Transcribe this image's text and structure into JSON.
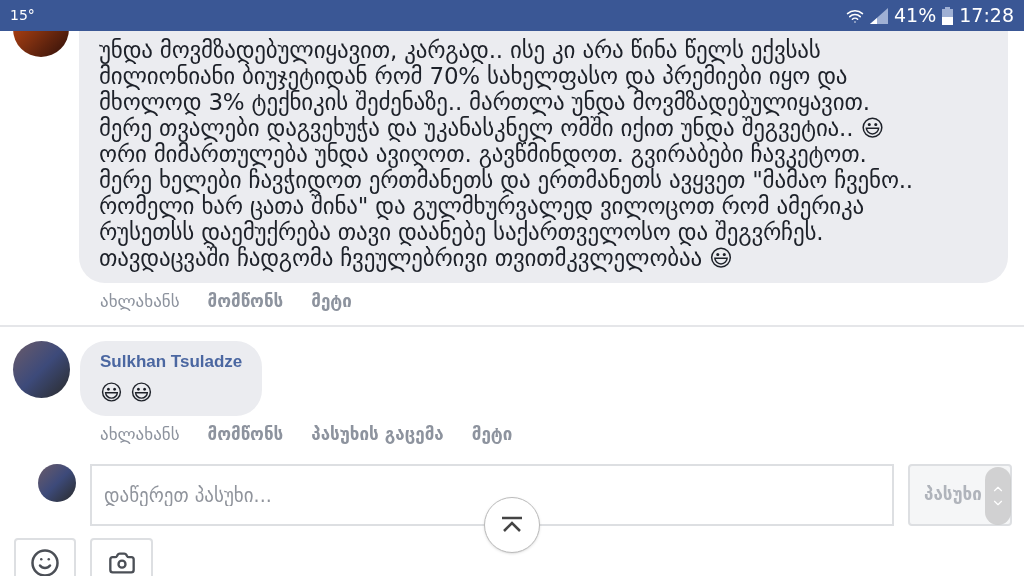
{
  "status_bar": {
    "temperature": "15°",
    "battery": "41%",
    "time": "17:28"
  },
  "comments": [
    {
      "text": "უნდა მოვმზადებულიყავით, კარგად.. ისე კი არა წინა წელს ექვსას\nმილიონიანი ბიუჯეტიდან რომ 70% სახელფასო და პრემიები იყო და\nმხოლოდ 3% ტექნიკის შეძენაზე.. მართლა უნდა მოვმზადებულიყავით.\nმერე თვალები დაგვეხუჭა და უკანასკნელ ომში იქით უნდა შეგვეტია.. 😃\nორი მიმართულება უნდა ავიღოთ. გავწმინდოთ. გვირაბები ჩავკეტოთ.\nმერე ხელები ჩავჭიდოთ ერთმანეთს და ერთმანეთს ავყვეთ \"მამაო ჩვენო..\nრომელი ხარ ცათა შინა\" და გულმხურვალედ ვილოცოთ რომ ამერიკა\nრუსეთსს დაემუქრება თავი დაანებე საქართველოსო და შეგვრჩეს.\nთავდაცვაში ჩადგომა ჩვეულებრივი თვითმკვლელობაა 😃",
      "actions": [
        "ახლახანს",
        "მომწონს",
        "მეტი"
      ]
    },
    {
      "author": "Sulkhan Tsuladze",
      "text": "😃 😃",
      "actions": [
        "ახლახანს",
        "მომწონს",
        "პასუხის გაცემა",
        "მეტი"
      ]
    }
  ],
  "reply": {
    "placeholder": "დაწერეთ პასუხი...",
    "button": "პასუხი"
  }
}
